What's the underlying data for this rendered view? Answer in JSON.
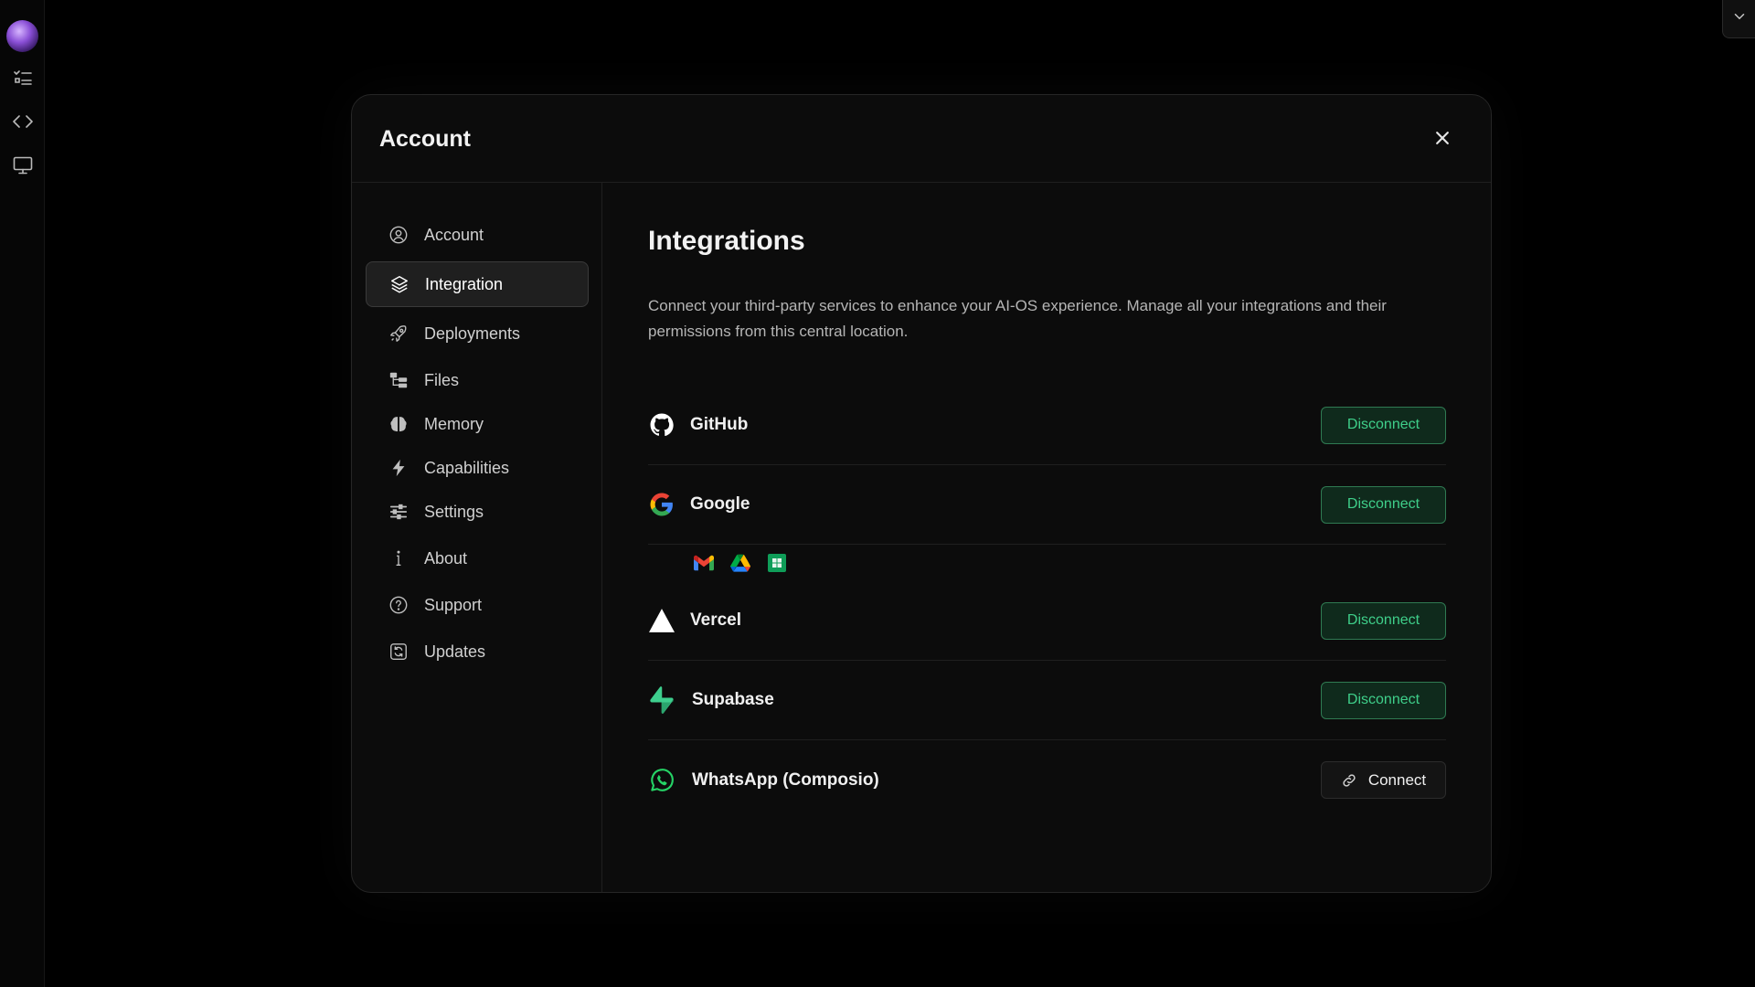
{
  "rail": {
    "items": [
      "avatar",
      "checklist-icon",
      "code-icon",
      "monitor-icon"
    ]
  },
  "modal": {
    "title": "Account",
    "close_icon": "close-icon"
  },
  "sidebar": {
    "items": [
      {
        "label": "Account",
        "icon": "user-circle-icon",
        "active": false
      },
      {
        "label": "Integration",
        "icon": "layers-icon",
        "active": true
      },
      {
        "label": "Deployments",
        "icon": "rocket-icon",
        "active": false
      },
      {
        "label": "Files",
        "icon": "folder-tree-icon",
        "active": false
      },
      {
        "label": "Memory",
        "icon": "brain-icon",
        "active": false
      },
      {
        "label": "Capabilities",
        "icon": "lightning-icon",
        "active": false
      },
      {
        "label": "Settings",
        "icon": "sliders-icon",
        "active": false
      },
      {
        "label": "About",
        "icon": "info-icon",
        "active": false
      },
      {
        "label": "Support",
        "icon": "help-circle-icon",
        "active": false
      },
      {
        "label": "Updates",
        "icon": "refresh-square-icon",
        "active": false
      }
    ]
  },
  "main": {
    "title": "Integrations",
    "description": "Connect your third-party services to enhance your AI-OS experience. Manage all your integrations and their permissions from this central location.",
    "integrations": [
      {
        "name": "GitHub",
        "icon": "github-icon",
        "action": "Disconnect",
        "connected": true
      },
      {
        "name": "Google",
        "icon": "google-icon",
        "action": "Disconnect",
        "connected": true,
        "services": [
          "gmail-icon",
          "google-drive-icon",
          "google-sheets-icon"
        ]
      },
      {
        "name": "Vercel",
        "icon": "vercel-icon",
        "action": "Disconnect",
        "connected": true
      },
      {
        "name": "Supabase",
        "icon": "supabase-icon",
        "action": "Disconnect",
        "connected": true
      },
      {
        "name": "WhatsApp (Composio)",
        "icon": "whatsapp-icon",
        "action": "Connect",
        "connected": false
      }
    ]
  },
  "colors": {
    "accent_green": "#3fcf8a",
    "accent_green_bg": "#0f2a1c",
    "background": "#000000",
    "modal_bg": "#0c0c0c"
  }
}
